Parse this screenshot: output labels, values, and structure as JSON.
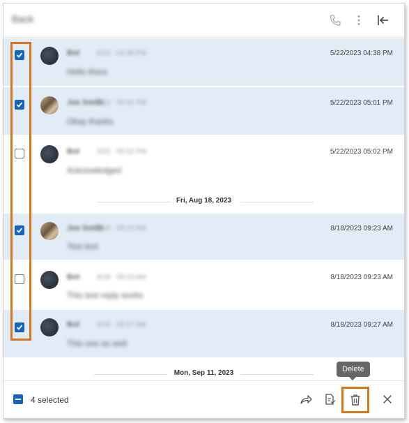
{
  "header": {
    "title": "Back"
  },
  "messages": [
    {
      "sender": "Bot",
      "subtitle": "5/22 · 04:38 PM",
      "text": "Hello there",
      "time": "5/22/2023 04:38 PM",
      "selected": true,
      "avatar": "dark"
    },
    {
      "sender": "Joe Smith",
      "subtitle": "5/22 · 05:01 PM",
      "text": "Okay thanks",
      "time": "5/22/2023 05:01 PM",
      "selected": true,
      "avatar": "photo"
    },
    {
      "sender": "Bot",
      "subtitle": "5/22 · 05:02 PM",
      "text": "Acknowledged",
      "time": "5/22/2023 05:02 PM",
      "selected": false,
      "avatar": "dark"
    },
    {
      "sender": "Joe Smith",
      "subtitle": "8/18 · 09:23 AM",
      "text": "Test text",
      "time": "8/18/2023 09:23 AM",
      "selected": true,
      "avatar": "photo"
    },
    {
      "sender": "Bot",
      "subtitle": "8/18 · 09:23 AM",
      "text": "This test reply works",
      "time": "8/18/2023 09:23 AM",
      "selected": false,
      "avatar": "dark"
    },
    {
      "sender": "Bot",
      "subtitle": "8/18 · 09:27 AM",
      "text": "This one as well",
      "time": "8/18/2023 09:27 AM",
      "selected": true,
      "avatar": "dark"
    }
  ],
  "dividers": [
    "Fri, Aug 18, 2023",
    "Mon, Sep 11, 2023"
  ],
  "footer": {
    "selected_label": "4 selected",
    "tooltip": "Delete"
  },
  "icons": [
    "phone-icon",
    "more-vertical-icon",
    "collapse-left-icon",
    "forward-icon",
    "export-icon",
    "trash-icon",
    "close-icon"
  ],
  "colors": {
    "accent": "#1565c0",
    "highlight": "#d9761a",
    "selected_row": "#e2ecf7"
  }
}
